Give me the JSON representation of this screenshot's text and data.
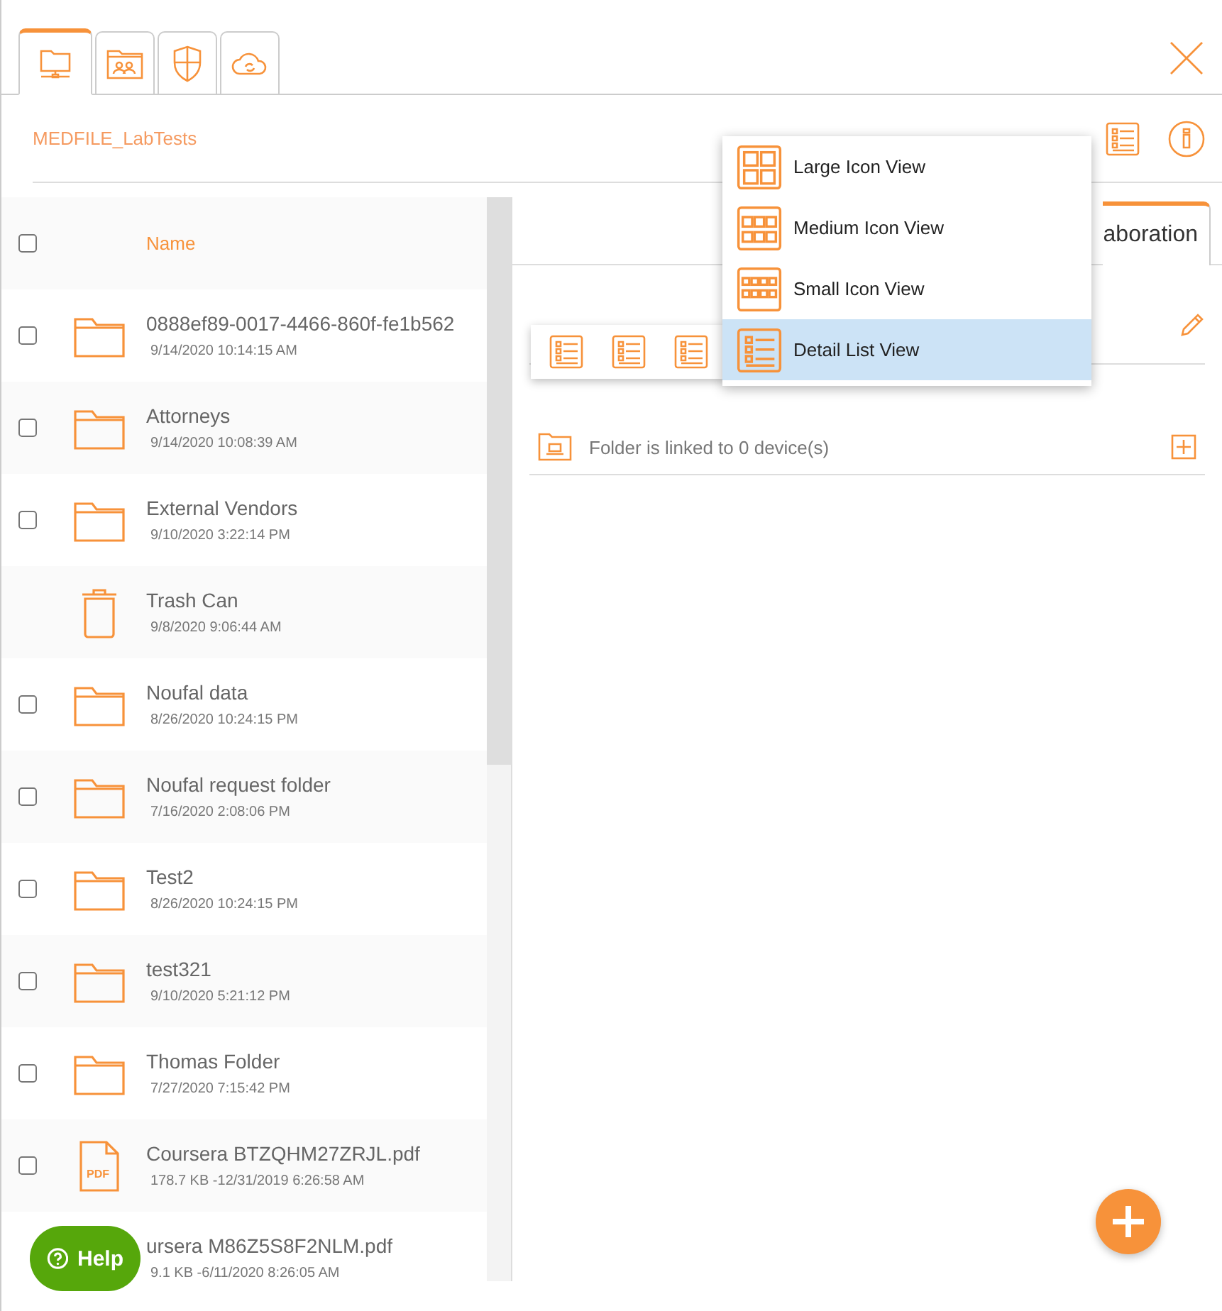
{
  "tabs": [
    {
      "kind": "network",
      "selected": true
    },
    {
      "kind": "shared",
      "selected": false
    },
    {
      "kind": "security",
      "selected": false
    },
    {
      "kind": "cloud",
      "selected": false
    }
  ],
  "breadcrumb": "MEDFILE_LabTests",
  "list_header": {
    "checked": false,
    "label": "Name"
  },
  "rows": [
    {
      "kind": "folder",
      "name": "0888ef89-0017-4466-860f-fe1b562",
      "meta": "9/14/2020 10:14:15 AM",
      "checked": false
    },
    {
      "kind": "folder",
      "name": "Attorneys",
      "meta": "9/14/2020 10:08:39 AM",
      "checked": false
    },
    {
      "kind": "folder",
      "name": "External Vendors",
      "meta": "9/10/2020 3:22:14 PM",
      "checked": false
    },
    {
      "kind": "trash",
      "name": "Trash Can",
      "meta": "9/8/2020 9:06:44 AM"
    },
    {
      "kind": "folder",
      "name": "Noufal data",
      "meta": "8/26/2020 10:24:15 PM",
      "checked": false
    },
    {
      "kind": "folder",
      "name": "Noufal request folder",
      "meta": "7/16/2020 2:08:06 PM",
      "checked": false
    },
    {
      "kind": "folder",
      "name": "Test2",
      "meta": "8/26/2020 10:24:15 PM",
      "checked": false
    },
    {
      "kind": "folder",
      "name": "test321",
      "meta": "9/10/2020 5:21:12 PM",
      "checked": false
    },
    {
      "kind": "folder",
      "name": "Thomas Folder",
      "meta": "7/27/2020 7:15:42 PM",
      "checked": false
    },
    {
      "kind": "pdf",
      "badge": "PDF",
      "name": "Coursera BTZQHM27ZRJL.pdf",
      "meta": "178.7 KB -12/31/2019 6:26:58 AM",
      "checked": false
    },
    {
      "kind": "covered",
      "name": "ursera M86Z5S8F2NLM.pdf",
      "meta": "9.1 KB -6/11/2020 8:26:05 AM"
    }
  ],
  "detail_tab": {
    "label": "aboration",
    "selected": true
  },
  "linked_devices": "Folder is linked to 0 device(s)",
  "view_toolbar": [
    {
      "kind": "list"
    },
    {
      "kind": "list"
    },
    {
      "kind": "list"
    }
  ],
  "view_menu": [
    {
      "kind": "large",
      "label": "Large Icon View",
      "selected": false
    },
    {
      "kind": "medium",
      "label": "Medium Icon View",
      "selected": false
    },
    {
      "kind": "small",
      "label": "Small Icon View",
      "selected": false
    },
    {
      "kind": "list",
      "label": "Detail List View",
      "selected": true
    }
  ],
  "help": "Help"
}
